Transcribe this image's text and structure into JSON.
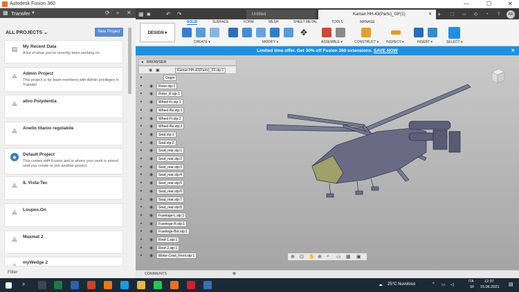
{
  "window": {
    "title": "Autodesk Fusion 360",
    "minimize": "—",
    "maximize": "☐",
    "close": "✕"
  },
  "left_panel": {
    "header": "Transfer",
    "all_projects": "ALL PROJECTS",
    "new_project": "New Project",
    "filter": "Filter",
    "projects": [
      {
        "title": "My Recent Data",
        "desc": "A list of what you've recently been working on"
      },
      {
        "title": "Admin Project",
        "desc": "This project is for team members with Admin privileges in Transfer"
      },
      {
        "title": "altro Polydentia",
        "desc": ""
      },
      {
        "title": "Anello titanio regolabile",
        "desc": ""
      },
      {
        "title": "Default Project",
        "desc": "This comes with Fusion and is where your work is stored until you create or join another project."
      },
      {
        "title": "IL Vista-Tec",
        "desc": ""
      },
      {
        "title": "Loupes.On",
        "desc": ""
      },
      {
        "title": "Maxmat 2",
        "desc": ""
      },
      {
        "title": "myWedge 2",
        "desc": ""
      }
    ]
  },
  "tabs": [
    {
      "label": "Untitled",
      "active": false
    },
    {
      "label": "Kaman HH-43(Parts)_03*(1)",
      "active": true
    }
  ],
  "toolbar": {
    "workspace": "DESIGN ▾",
    "sub_tabs": [
      "SOLID",
      "SURFACE",
      "FORM",
      "MESH",
      "SHEET METAL",
      "TOOLS",
      "MANAGE"
    ],
    "groups": [
      "CREATE ▾",
      "MODIFY ▾",
      "ASSEMBLE ▾",
      "CONSTRUCT ▾",
      "INSPECT ▾",
      "INSERT ▾",
      "SELECT ▾"
    ],
    "accent": "#1f8fe0"
  },
  "banner": {
    "text": "Limited time offer. Get 30% off Fusion 360 extensions.",
    "link": "SAVE NOW",
    "close": "✕"
  },
  "browser": {
    "label": "BROWSER",
    "root": "Kaman HH-43(Parts)_03.stp:1",
    "items": [
      "Origin",
      "Rotor.stp:1",
      "Rotor_R.stp:1",
      "Wheel-Fr.stp:1",
      "Wheel-Re.stp:1",
      "Wheel-Fr.stp:2",
      "Wheel-Re.stp:2",
      "Seat.stp:1",
      "Seat.stp:2",
      "Seat_rear.stp:1",
      "Seat_rear.stp:2",
      "Seat_rear.stp:3",
      "Seat_rear.stp:4",
      "Seat_rear.stp:5",
      "Seat_rear.stp:6",
      "Seat_rear.stp:7",
      "Seat_rear.stp:8",
      "Fuselage-L.stp:1",
      "Fuselege-R.stp:1",
      "Fuselege-Bot.stp:1",
      "Roof-1.stp:1",
      "Roof-2.stp:1",
      "Motor-Cowl_Front.stp:1"
    ]
  },
  "comments": {
    "label": "COMMENTS"
  },
  "taskbar": {
    "weather": "25°C  Nuvoloso",
    "lang1": "ITA",
    "lang2": "SF",
    "time": "12:37",
    "date": "15.06.2021"
  }
}
